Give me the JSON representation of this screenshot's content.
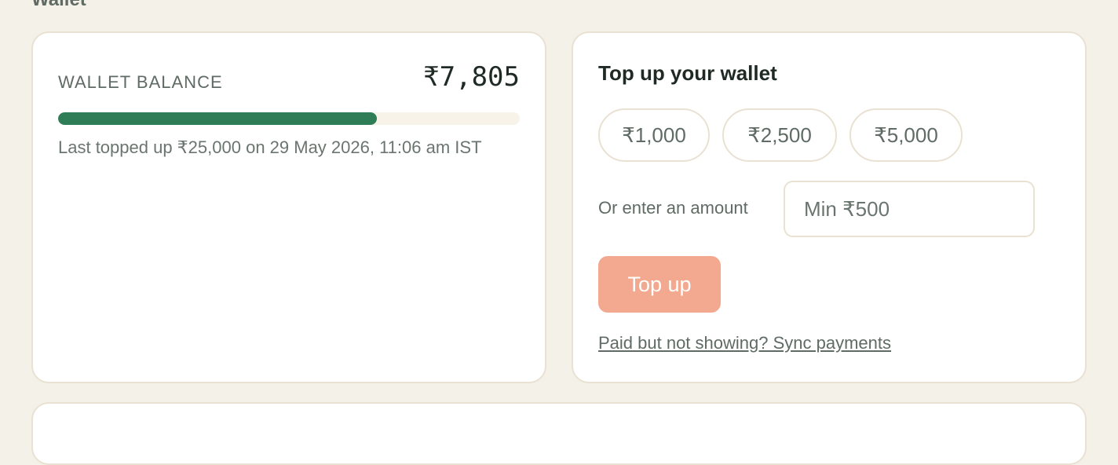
{
  "page": {
    "section_title": "Wallet"
  },
  "balance": {
    "label": "WALLET BALANCE",
    "amount": "₹7,805",
    "progress_fraction": 0.69,
    "meta": "Last topped up ₹25,000 on 29 May 2026, 11:06 am IST"
  },
  "topup": {
    "title": "Top up your wallet",
    "presets": [
      "₹1,000",
      "₹2,500",
      "₹5,000"
    ],
    "custom_label": "Or enter an amount",
    "custom_placeholder": "Min ₹500",
    "button_label": "Top up",
    "sync_link": "Paid but not showing? Sync payments"
  },
  "colors": {
    "background": "#f4f1e8",
    "progress_fill": "#2e7d57",
    "progress_track": "#f7f3e8",
    "topup_button": "#f3a98f",
    "card_border": "#e9e2d2"
  }
}
